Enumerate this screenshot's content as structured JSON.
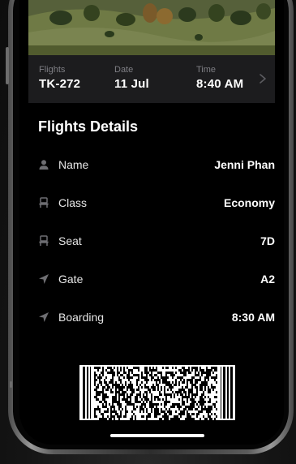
{
  "flight": {
    "flights_label": "Flights",
    "flights_value": "TK-272",
    "date_label": "Date",
    "date_value": "11 Jul",
    "time_label": "Time",
    "time_value": "8:40 AM"
  },
  "details": {
    "title": "Flights Details",
    "rows": [
      {
        "icon": "person-icon",
        "label": "Name",
        "value": "Jenni Phan"
      },
      {
        "icon": "seat-icon",
        "label": "Class",
        "value": "Economy"
      },
      {
        "icon": "seat-icon",
        "label": "Seat",
        "value": "7D"
      },
      {
        "icon": "navigation-arrow-icon",
        "label": "Gate",
        "value": "A2"
      },
      {
        "icon": "navigation-arrow-icon",
        "label": "Boarding",
        "value": "8:30 AM"
      }
    ]
  },
  "colors": {
    "screen_bg": "#000000",
    "info_bar_bg": "#1c1c1e",
    "label_gray": "#7e7e84"
  }
}
